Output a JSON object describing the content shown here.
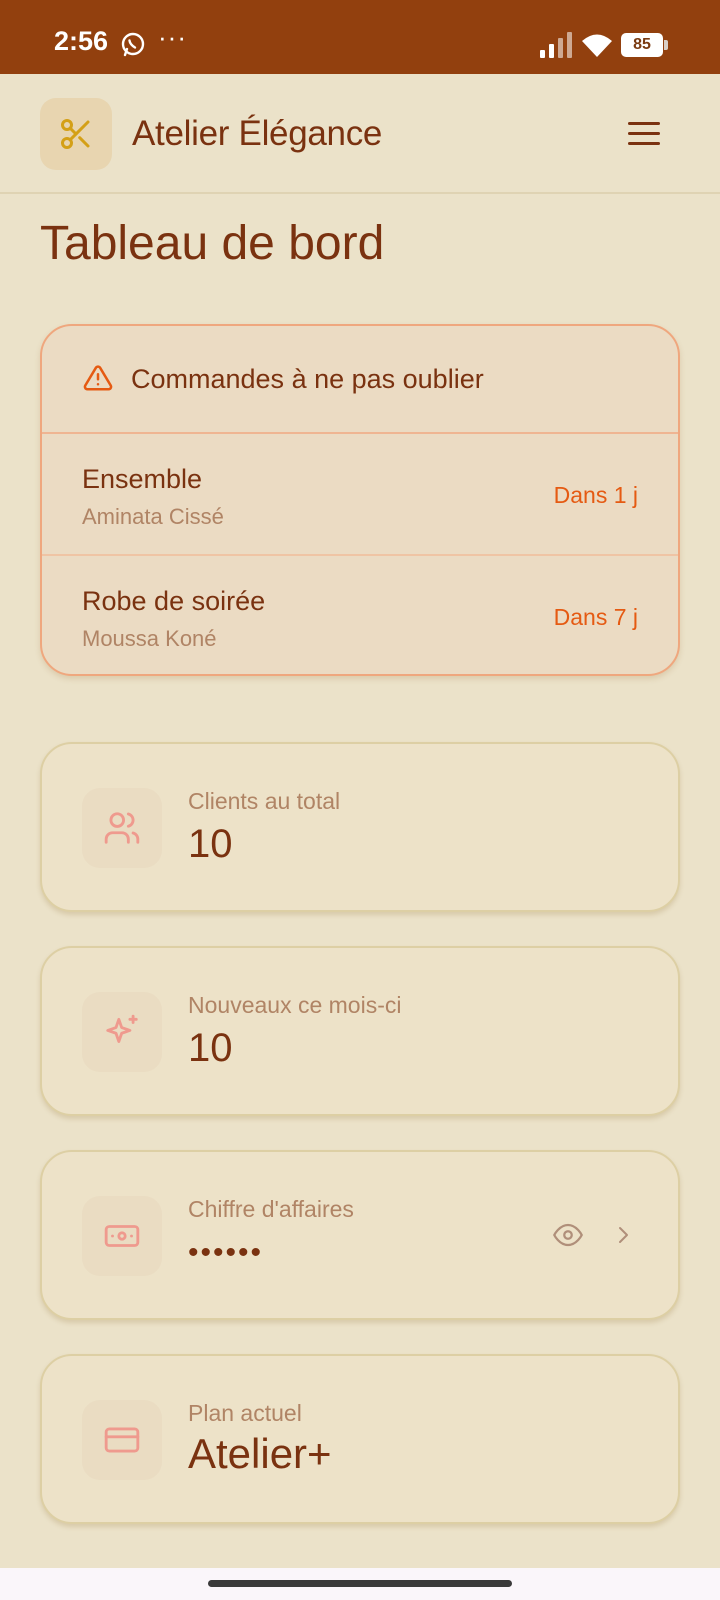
{
  "status_bar": {
    "time": "2:56",
    "overflow_dots": "···",
    "battery_level": "85",
    "background_color": "#92400E"
  },
  "app": {
    "title": "Atelier Élégance",
    "logo_icon": "scissors-icon",
    "menu_icon": "hamburger-menu-icon"
  },
  "page": {
    "title": "Tableau de bord"
  },
  "reminders": {
    "title": "Commandes à ne pas oublier",
    "icon": "warning-triangle-icon",
    "items": [
      {
        "name": "Ensemble",
        "client": "Aminata Cissé",
        "due": "Dans 1 j"
      },
      {
        "name": "Robe de soirée",
        "client": "Moussa Koné",
        "due": "Dans 7 j"
      }
    ]
  },
  "stats": {
    "clients_total": {
      "label": "Clients au total",
      "value": "10",
      "icon": "users-icon"
    },
    "new_this_month": {
      "label": "Nouveaux ce mois-ci",
      "value": "10",
      "icon": "sparkles-icon"
    },
    "revenue": {
      "label": "Chiffre d'affaires",
      "value": "••••••",
      "icon": "banknote-icon",
      "action_icons": [
        "eye-icon",
        "chevron-right-icon"
      ]
    },
    "plan": {
      "label": "Plan actuel",
      "value": "Atelier+",
      "icon": "credit-card-icon"
    }
  },
  "colors": {
    "accent": "#92400E",
    "text": "#7A3210",
    "muted_text": "#B08465",
    "alert": "#E55A12",
    "background": "#EBE2C9",
    "icon_pink": "#EF9A8E",
    "logo_gold": "#D4A017"
  }
}
